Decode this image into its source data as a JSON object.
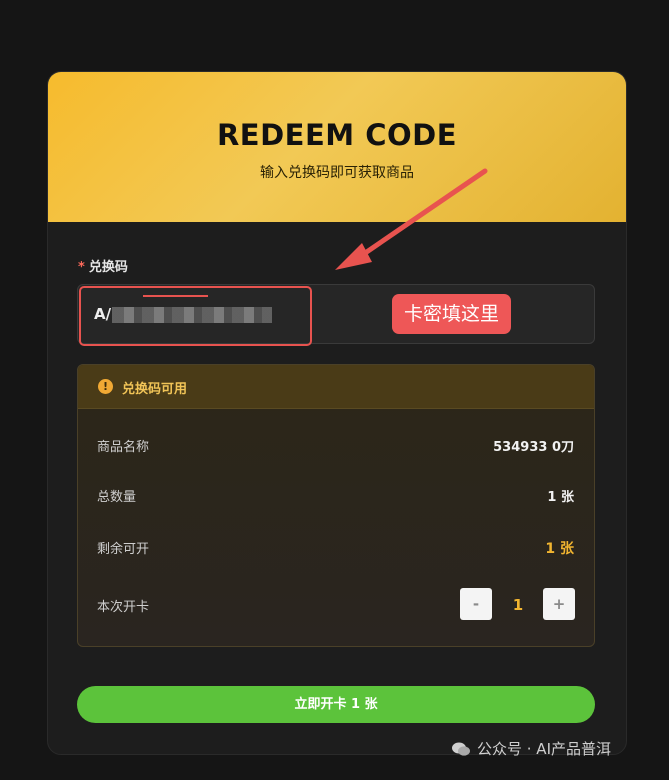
{
  "header": {
    "title": "REDEEM CODE",
    "subtitle": "输入兑换码即可获取商品"
  },
  "form": {
    "required_mark": "*",
    "code_label": "兑换码",
    "code_value": "A/"
  },
  "annotation": {
    "text": "卡密填这里",
    "color": "#ee5757"
  },
  "status": {
    "icon": "warning-icon",
    "title": "兑换码可用",
    "rows": [
      {
        "label": "商品名称",
        "value": "534933 0刀"
      },
      {
        "label": "总数量",
        "value": "1 张"
      },
      {
        "label": "剩余可开",
        "value": "1 张"
      }
    ],
    "quantity": {
      "label": "本次开卡",
      "minus": "-",
      "value": "1",
      "plus": "+"
    }
  },
  "submit": {
    "label": "立即开卡 1 张",
    "color": "#5cc33b"
  },
  "watermark": {
    "text": "公众号 · AI产品普洱"
  },
  "colors": {
    "accent_gold": "#f2b530",
    "header_gradient": "#f6bb2d"
  }
}
